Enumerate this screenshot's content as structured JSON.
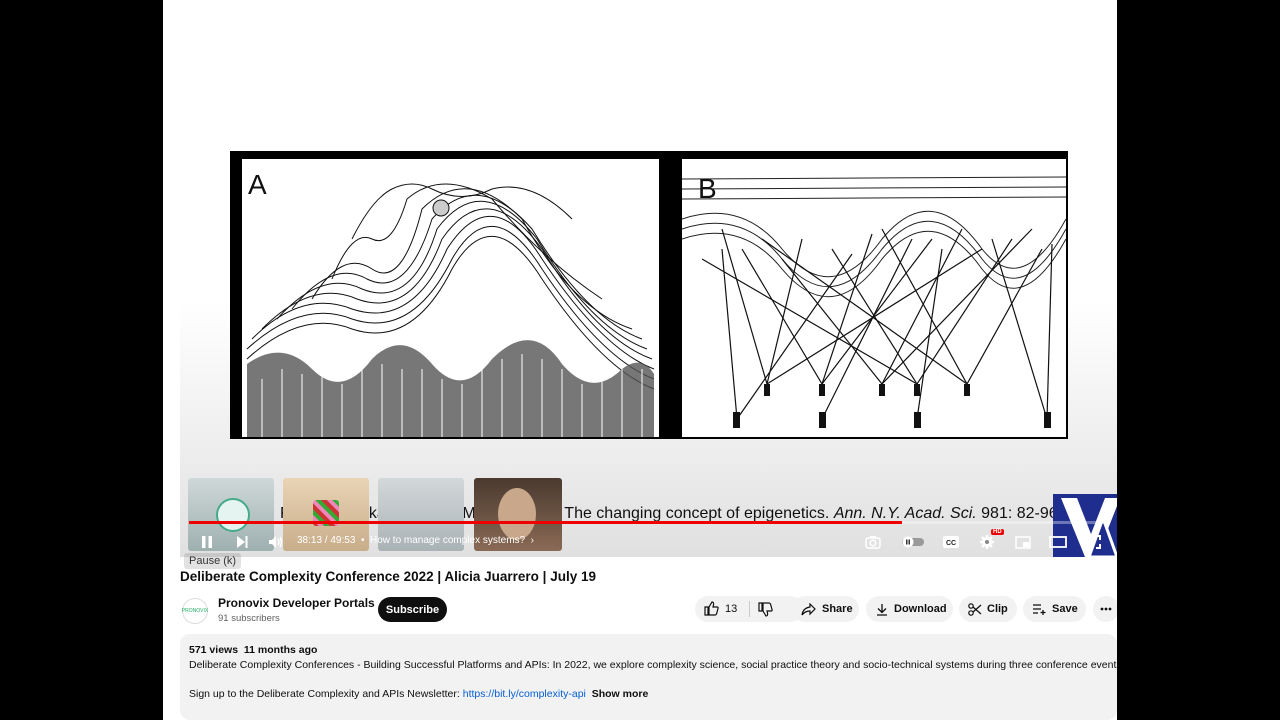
{
  "video": {
    "slide": {
      "panel_a_label": "A",
      "panel_b_label": "B",
      "citation_prefix": "From Jablonka , Eva and Marion Lamb, The changing concept of epigenetics. ",
      "citation_journal": "Ann. N.Y. Acad. Sci.",
      "citation_suffix": " 981: 82-96 (2002)"
    },
    "progress_fraction": 0.777,
    "time_display": "38:13 / 49:53",
    "chapter": "How to manage complex systems?",
    "tooltip": "Pause (k)",
    "hd_badge": "HD",
    "icons": [
      "pause-icon",
      "next-icon",
      "volume-icon",
      "screenshot-icon",
      "autoplay-toggle-icon",
      "captions-icon",
      "settings-icon",
      "miniplayer-icon",
      "theater-icon",
      "fullscreen-icon"
    ]
  },
  "title": "Deliberate Complexity Conference 2022 | Alicia Juarrero | July 19",
  "channel": {
    "avatar_text": "PRONOVIX",
    "name": "Pronovix Developer Portals",
    "subscribers": "91 subscribers",
    "subscribe_label": "Subscribe"
  },
  "actions": {
    "likes": "13",
    "share": "Share",
    "download": "Download",
    "clip": "Clip",
    "save": "Save"
  },
  "description": {
    "views": "571 views",
    "age": "11 months ago",
    "text": "Deliberate Complexity Conferences - Building Successful Platforms and APIs: In 2022, we explore complexity science, social practice theory and socio-technical systems during three conference events.",
    "signup": "Sign up to the Deliberate Complexity and APIs Newsletter: ",
    "link": "https://bit.ly/complexity-api",
    "show_more": "Show more"
  },
  "colors": {
    "accent": "#e00000",
    "link": "#065fd4",
    "logo": "#1f2d8f"
  }
}
